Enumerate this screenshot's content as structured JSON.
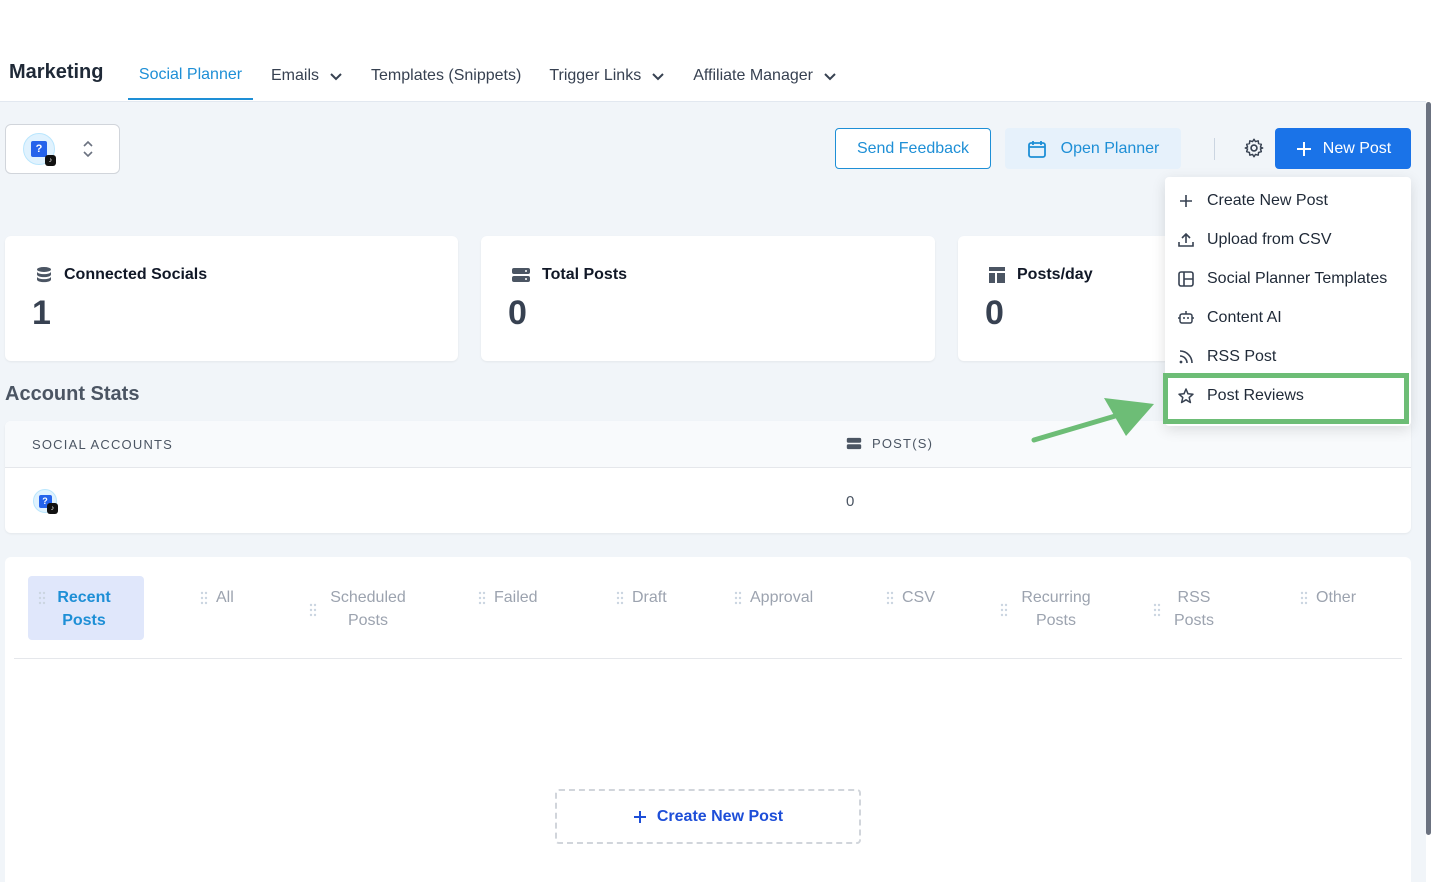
{
  "header": {
    "brand": "Marketing",
    "nav": [
      {
        "label": "Social Planner",
        "active": true,
        "dropdown": false
      },
      {
        "label": "Emails",
        "active": false,
        "dropdown": true
      },
      {
        "label": "Templates (Snippets)",
        "active": false,
        "dropdown": false
      },
      {
        "label": "Trigger Links",
        "active": false,
        "dropdown": true
      },
      {
        "label": "Affiliate Manager",
        "active": false,
        "dropdown": true
      }
    ]
  },
  "actions": {
    "feedback_label": "Send Feedback",
    "planner_label": "Open Planner",
    "new_post_label": "New Post"
  },
  "stats": [
    {
      "title": "Connected Socials",
      "value": "1",
      "icon": "database-icon"
    },
    {
      "title": "Total Posts",
      "value": "0",
      "icon": "server-icon"
    },
    {
      "title": "Posts/day",
      "value": "0",
      "icon": "layout-icon"
    }
  ],
  "account_stats": {
    "title": "Account Stats",
    "col_social": "SOCIAL ACCOUNTS",
    "col_posts": "POST(S)",
    "rows": [
      {
        "posts": "0"
      }
    ]
  },
  "post_tabs": [
    {
      "label": "Recent Posts",
      "active": true
    },
    {
      "label": "All",
      "active": false
    },
    {
      "label": "Scheduled Posts",
      "active": false
    },
    {
      "label": "Failed",
      "active": false
    },
    {
      "label": "Draft",
      "active": false
    },
    {
      "label": "Approval",
      "active": false
    },
    {
      "label": "CSV",
      "active": false
    },
    {
      "label": "Recurring Posts",
      "active": false
    },
    {
      "label": "RSS Posts",
      "active": false
    },
    {
      "label": "Other",
      "active": false
    }
  ],
  "empty_state": {
    "create_label": "Create New Post"
  },
  "menu": {
    "items": [
      {
        "label": "Create New Post",
        "icon": "plus-icon"
      },
      {
        "label": "Upload from CSV",
        "icon": "upload-icon"
      },
      {
        "label": "Social Planner Templates",
        "icon": "template-icon"
      },
      {
        "label": "Content AI",
        "icon": "robot-icon"
      },
      {
        "label": "RSS Post",
        "icon": "rss-icon"
      },
      {
        "label": "Post Reviews",
        "icon": "star-icon"
      }
    ]
  },
  "colors": {
    "accent": "#1e8fd6",
    "primary_button": "#1a73e8",
    "highlight": "#6dbd76"
  }
}
